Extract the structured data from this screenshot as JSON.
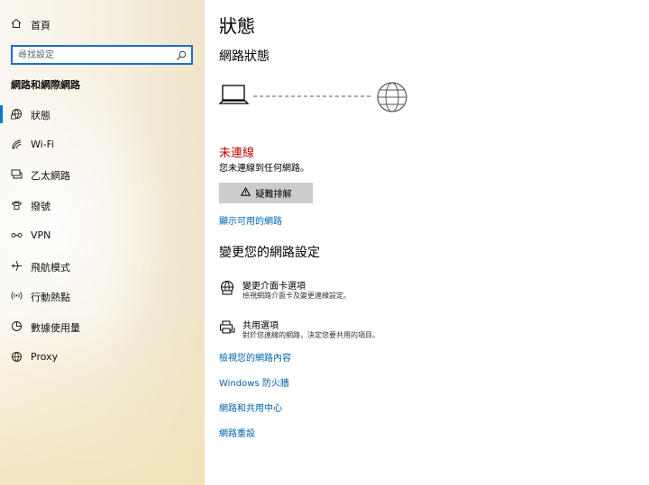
{
  "sidebar": {
    "home_label": "首頁",
    "search_placeholder": "尋找設定",
    "section_title": "網路和網際網路",
    "items": [
      {
        "label": "狀態",
        "icon": "status-icon",
        "active": true
      },
      {
        "label": "Wi-Fi",
        "icon": "wifi-icon",
        "active": false
      },
      {
        "label": "乙太網路",
        "icon": "ethernet-icon",
        "active": false
      },
      {
        "label": "撥號",
        "icon": "dialup-icon",
        "active": false
      },
      {
        "label": "VPN",
        "icon": "vpn-icon",
        "active": false
      },
      {
        "label": "飛航模式",
        "icon": "airplane-icon",
        "active": false
      },
      {
        "label": "行動熱點",
        "icon": "hotspot-icon",
        "active": false
      },
      {
        "label": "數據使用量",
        "icon": "data-usage-icon",
        "active": false
      },
      {
        "label": "Proxy",
        "icon": "globe-icon",
        "active": false
      }
    ]
  },
  "main": {
    "title": "狀態",
    "network_status_heading": "網路狀態",
    "connection_state": "未連線",
    "connection_desc": "您未連線到任何網路。",
    "troubleshoot_label": "疑難排解",
    "show_networks_link": "顯示可用的網路",
    "change_settings_heading": "變更您的網路設定",
    "options": [
      {
        "title": "變更介面卡選項",
        "desc": "檢視網路介面卡及變更連線設定。",
        "icon": "adapter-icon"
      },
      {
        "title": "共用選項",
        "desc": "對於您連線的網路，決定您要共用的項目。",
        "icon": "sharing-icon"
      }
    ],
    "links": [
      "檢視您的網路內容",
      "Windows 防火牆",
      "網路和共用中心",
      "網路重設"
    ]
  },
  "colors": {
    "accent": "#0078d7",
    "link": "#0063b1",
    "error": "#c50500",
    "button_bg": "#cccccc"
  }
}
